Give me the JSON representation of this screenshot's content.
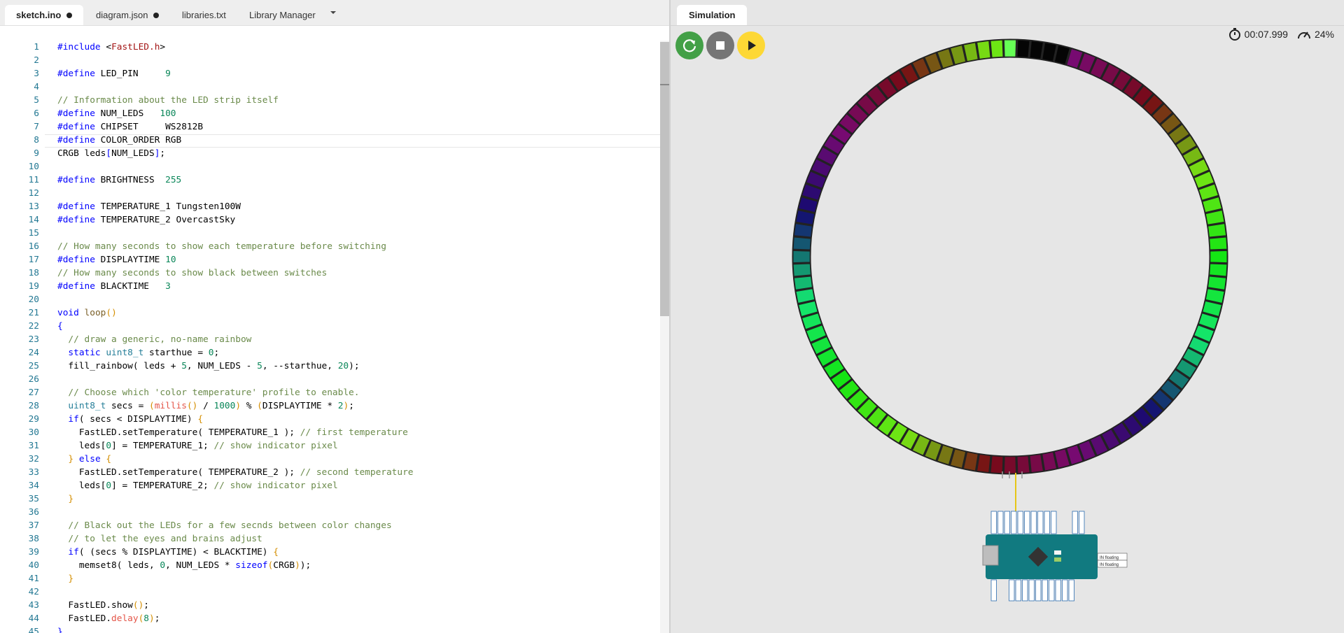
{
  "editor": {
    "tabs": [
      {
        "label": "sketch.ino",
        "modified": true,
        "active": true
      },
      {
        "label": "diagram.json",
        "modified": true,
        "active": false
      },
      {
        "label": "libraries.txt",
        "modified": false,
        "active": false
      },
      {
        "label": "Library Manager",
        "modified": false,
        "active": false
      }
    ],
    "dropdown_icon": "caret-down-icon",
    "lines": [
      {
        "n": "1",
        "parts": [
          [
            "k",
            "#include "
          ],
          [
            "",
            "<"
          ],
          [
            "s",
            "FastLED.h"
          ],
          [
            "",
            ">"
          ]
        ]
      },
      {
        "n": "2",
        "parts": []
      },
      {
        "n": "3",
        "parts": [
          [
            "k",
            "#define"
          ],
          [
            "",
            " LED_PIN     "
          ],
          [
            "n",
            "9"
          ]
        ]
      },
      {
        "n": "4",
        "parts": []
      },
      {
        "n": "5",
        "parts": [
          [
            "c",
            "// Information about the LED strip itself"
          ]
        ]
      },
      {
        "n": "6",
        "parts": [
          [
            "k",
            "#define"
          ],
          [
            "",
            " NUM_LEDS   "
          ],
          [
            "n",
            "100"
          ]
        ]
      },
      {
        "n": "7",
        "parts": [
          [
            "k",
            "#define"
          ],
          [
            "",
            " CHIPSET     WS2812B"
          ]
        ]
      },
      {
        "n": "8",
        "parts": [
          [
            "k",
            "#define"
          ],
          [
            "",
            " COLOR_ORDER RGB"
          ]
        ]
      },
      {
        "n": "9",
        "parts": [
          [
            "",
            "CRGB leds"
          ],
          [
            "k",
            "["
          ],
          [
            "",
            "NUM_LEDS"
          ],
          [
            "k",
            "]"
          ],
          [
            "",
            ";"
          ]
        ]
      },
      {
        "n": "10",
        "parts": []
      },
      {
        "n": "11",
        "parts": [
          [
            "k",
            "#define"
          ],
          [
            "",
            " BRIGHTNESS  "
          ],
          [
            "n",
            "255"
          ]
        ]
      },
      {
        "n": "12",
        "parts": []
      },
      {
        "n": "13",
        "parts": [
          [
            "k",
            "#define"
          ],
          [
            "",
            " TEMPERATURE_1 Tungsten100W"
          ]
        ]
      },
      {
        "n": "14",
        "parts": [
          [
            "k",
            "#define"
          ],
          [
            "",
            " TEMPERATURE_2 OvercastSky"
          ]
        ]
      },
      {
        "n": "15",
        "parts": []
      },
      {
        "n": "16",
        "parts": [
          [
            "c",
            "// How many seconds to show each temperature before switching"
          ]
        ]
      },
      {
        "n": "17",
        "parts": [
          [
            "k",
            "#define"
          ],
          [
            "",
            " DISPLAYTIME "
          ],
          [
            "n",
            "10"
          ]
        ]
      },
      {
        "n": "18",
        "parts": [
          [
            "c",
            "// How many seconds to show black between switches"
          ]
        ]
      },
      {
        "n": "19",
        "parts": [
          [
            "k",
            "#define"
          ],
          [
            "",
            " BLACKTIME   "
          ],
          [
            "n",
            "3"
          ]
        ]
      },
      {
        "n": "20",
        "parts": []
      },
      {
        "n": "21",
        "parts": [
          [
            "k",
            "void "
          ],
          [
            "f",
            "loop"
          ],
          [
            "g",
            "()"
          ]
        ]
      },
      {
        "n": "22",
        "parts": [
          [
            "k",
            "{"
          ]
        ]
      },
      {
        "n": "23",
        "parts": [
          [
            "c",
            "  // draw a generic, no-name rainbow"
          ]
        ]
      },
      {
        "n": "24",
        "parts": [
          [
            "k",
            "  static "
          ],
          [
            "t",
            "uint8_t"
          ],
          [
            "",
            " starthue = "
          ],
          [
            "n",
            "0"
          ],
          [
            "",
            ";"
          ]
        ]
      },
      {
        "n": "25",
        "parts": [
          [
            "",
            "  fill_rainbow( leds + "
          ],
          [
            "n",
            "5"
          ],
          [
            "",
            ", NUM_LEDS - "
          ],
          [
            "n",
            "5"
          ],
          [
            "",
            ", --starthue, "
          ],
          [
            "n",
            "20"
          ],
          [
            "",
            ");"
          ]
        ]
      },
      {
        "n": "26",
        "parts": []
      },
      {
        "n": "27",
        "parts": [
          [
            "c",
            "  // Choose which 'color temperature' profile to enable."
          ]
        ]
      },
      {
        "n": "28",
        "parts": [
          [
            "t",
            "  uint8_t"
          ],
          [
            "",
            " secs = "
          ],
          [
            "g",
            "("
          ],
          [
            "m",
            "millis"
          ],
          [
            "g",
            "()"
          ],
          [
            "",
            " / "
          ],
          [
            "n",
            "1000"
          ],
          [
            "g",
            ")"
          ],
          [
            "",
            " % "
          ],
          [
            "g",
            "("
          ],
          [
            "",
            "DISPLAYTIME * "
          ],
          [
            "n",
            "2"
          ],
          [
            "g",
            ")"
          ],
          [
            "",
            ";"
          ]
        ]
      },
      {
        "n": "29",
        "parts": [
          [
            "k",
            "  if"
          ],
          [
            "",
            "( secs < DISPLAYTIME) "
          ],
          [
            "g",
            "{"
          ]
        ]
      },
      {
        "n": "30",
        "parts": [
          [
            "",
            "    FastLED.setTemperature( TEMPERATURE_1 ); "
          ],
          [
            "c",
            "// first temperature"
          ]
        ]
      },
      {
        "n": "31",
        "parts": [
          [
            "",
            "    leds["
          ],
          [
            "n",
            "0"
          ],
          [
            "",
            "] = TEMPERATURE_1; "
          ],
          [
            "c",
            "// show indicator pixel"
          ]
        ]
      },
      {
        "n": "32",
        "parts": [
          [
            "g",
            "  }"
          ],
          [
            "k",
            " else "
          ],
          [
            "g",
            "{"
          ]
        ]
      },
      {
        "n": "33",
        "parts": [
          [
            "",
            "    FastLED.setTemperature( TEMPERATURE_2 ); "
          ],
          [
            "c",
            "// second temperature"
          ]
        ]
      },
      {
        "n": "34",
        "parts": [
          [
            "",
            "    leds["
          ],
          [
            "n",
            "0"
          ],
          [
            "",
            "] = TEMPERATURE_2; "
          ],
          [
            "c",
            "// show indicator pixel"
          ]
        ]
      },
      {
        "n": "35",
        "parts": [
          [
            "g",
            "  }"
          ]
        ]
      },
      {
        "n": "36",
        "parts": []
      },
      {
        "n": "37",
        "parts": [
          [
            "c",
            "  // Black out the LEDs for a few secnds between color changes"
          ]
        ]
      },
      {
        "n": "38",
        "parts": [
          [
            "c",
            "  // to let the eyes and brains adjust"
          ]
        ]
      },
      {
        "n": "39",
        "parts": [
          [
            "k",
            "  if"
          ],
          [
            "",
            "( (secs % DISPLAYTIME) < BLACKTIME) "
          ],
          [
            "g",
            "{"
          ]
        ]
      },
      {
        "n": "40",
        "parts": [
          [
            "",
            "    memset8( leds, "
          ],
          [
            "n",
            "0"
          ],
          [
            "",
            ", NUM_LEDS * "
          ],
          [
            "k",
            "sizeof"
          ],
          [
            "g",
            "("
          ],
          [
            "",
            "CRGB"
          ],
          [
            "g",
            ")"
          ],
          [
            "",
            ");"
          ]
        ]
      },
      {
        "n": "41",
        "parts": [
          [
            "g",
            "  }"
          ]
        ]
      },
      {
        "n": "42",
        "parts": []
      },
      {
        "n": "43",
        "parts": [
          [
            "",
            "  FastLED.show"
          ],
          [
            "g",
            "()"
          ],
          [
            "",
            ";"
          ]
        ]
      },
      {
        "n": "44",
        "parts": [
          [
            "",
            "  FastLED."
          ],
          [
            "m",
            "delay"
          ],
          [
            "g",
            "("
          ],
          [
            "n",
            "8"
          ],
          [
            "g",
            ")"
          ],
          [
            "",
            ";"
          ]
        ]
      },
      {
        "n": "45",
        "parts": [
          [
            "k",
            "}"
          ]
        ]
      }
    ]
  },
  "simulation": {
    "tab_label": "Simulation",
    "controls": [
      {
        "name": "restart-button",
        "icon": "restart-icon",
        "color": "#43a047"
      },
      {
        "name": "stop-button",
        "icon": "stop-icon",
        "color": "#757575"
      },
      {
        "name": "play-button",
        "icon": "play-icon",
        "color": "#fdd835"
      }
    ],
    "timer_icon": "stopwatch-icon",
    "elapsed": "00:07.999",
    "speed_icon": "speedometer-icon",
    "speed": "24%",
    "led_count": 100,
    "board_labels": [
      "IN floating",
      "IN floating"
    ]
  }
}
